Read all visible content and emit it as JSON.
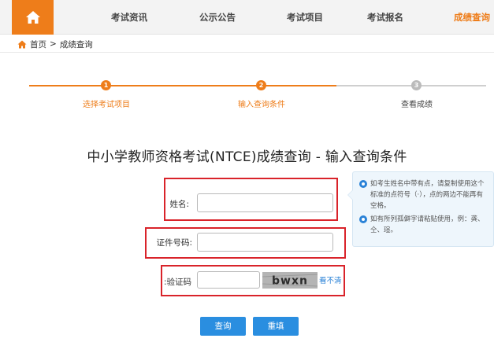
{
  "nav": {
    "items": [
      {
        "label": "考试资讯"
      },
      {
        "label": "公示公告"
      },
      {
        "label": "考试项目"
      },
      {
        "label": "考试报名"
      },
      {
        "label": "成绩查询"
      }
    ],
    "active_index": 4,
    "accent_color": "#ee7d1a"
  },
  "breadcrumb": {
    "home": "首页",
    "separator": ">",
    "current": "成绩查询"
  },
  "steps": [
    {
      "number": "1",
      "label": "选择考试项目",
      "state": "done"
    },
    {
      "number": "2",
      "label": "输入查询条件",
      "state": "current"
    },
    {
      "number": "3",
      "label": "查看成绩",
      "state": "pending"
    }
  ],
  "title": "中小学教师资格考试(NTCE)成绩查询 - 输入查询条件",
  "tips": [
    "如考生姓名中带有点，请复制使用这个标准的点符号（·），点的两边不能再有空格。",
    "如有所列孤僻字请粘贴使用，例：龚、仝、瑄。"
  ],
  "form": {
    "name_label": "姓名:",
    "name_value": "",
    "id_label": "证件号码:",
    "id_value": "",
    "captcha_label": "验证码:",
    "captcha_value": "",
    "captcha_text": "bwxn",
    "refresh_label": "看不清"
  },
  "buttons": {
    "query": "查询",
    "reset": "重填"
  },
  "colors": {
    "highlight_box": "#d9232a",
    "button": "#2a8ee0",
    "step_done": "#ee7d1a",
    "step_pending": "#bbbbbb"
  }
}
